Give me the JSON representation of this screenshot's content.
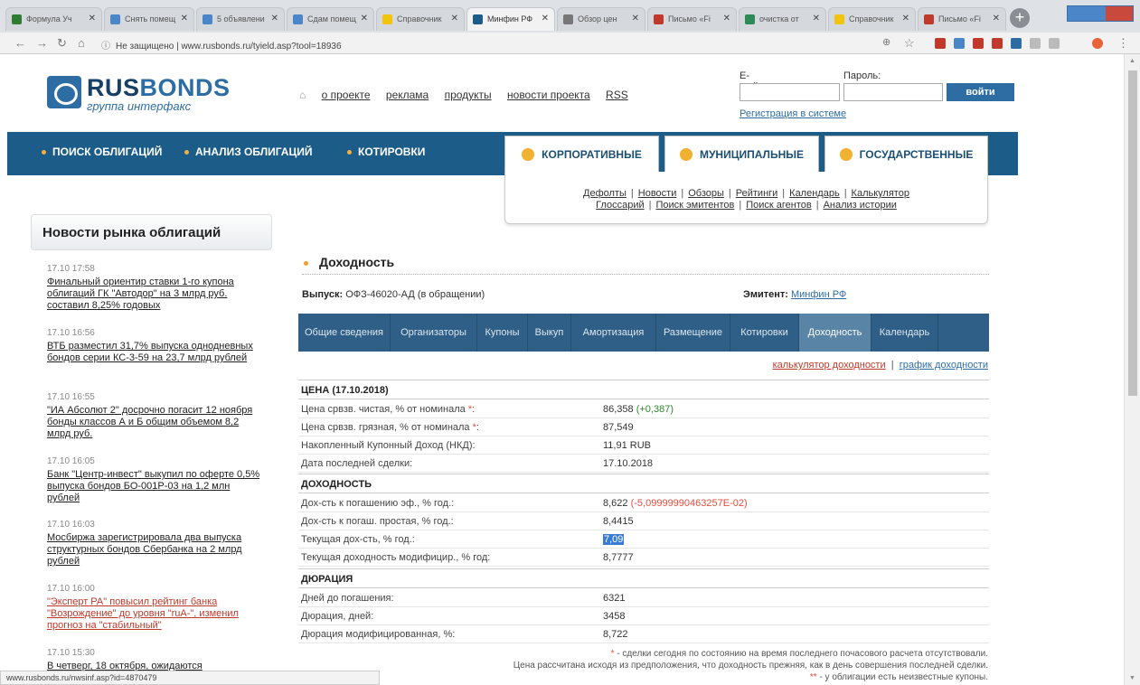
{
  "browser": {
    "tabs": [
      {
        "title": "Формула Уч",
        "color": "#2e7d32"
      },
      {
        "title": "Снять помещ",
        "color": "#4a86c8"
      },
      {
        "title": "5 объявлени",
        "color": "#4a86c8"
      },
      {
        "title": "Сдам помещ",
        "color": "#4a86c8"
      },
      {
        "title": "Справочник",
        "color": "#f1c40f"
      },
      {
        "title": "Минфин РФ",
        "color": "#1b5c88"
      },
      {
        "title": "Обзор цен",
        "color": "#777777"
      },
      {
        "title": "Письмо «Fi",
        "color": "#c0392b"
      },
      {
        "title": "очистка от",
        "color": "#2e8b57"
      },
      {
        "title": "Справочник",
        "color": "#f1c40f"
      },
      {
        "title": "Письмо «Fi",
        "color": "#c0392b"
      }
    ],
    "url_prefix": "Не защищено",
    "url": "www.rusbonds.ru/tyield.asp?tool=18936",
    "status_url": "www.rusbonds.ru/nwsinf.asp?id=4870479"
  },
  "header": {
    "logo_part1": "RUS",
    "logo_part2": "BONDS",
    "tagline": "группа интерфакс",
    "nav": [
      "о проекте",
      "реклама",
      "продукты",
      "новости проекта",
      "RSS"
    ],
    "email_label": "E-mail:",
    "password_label": "Пароль:",
    "login_button": "войти",
    "register_link": "Регистрация в системе"
  },
  "mainnav": {
    "items": [
      "ПОИСК ОБЛИГАЦИЙ",
      "АНАЛИЗ ОБЛИГАЦИЙ",
      "КОТИРОВКИ"
    ],
    "bigtabs": [
      "КОРПОРАТИВНЫЕ",
      "МУНИЦИПАЛЬНЫЕ",
      "ГОСУДАРСТВЕННЫЕ"
    ]
  },
  "submenu": {
    "row1": [
      "Дефолты",
      "Новости",
      "Обзоры",
      "Рейтинги",
      "Календарь",
      "Калькулятор"
    ],
    "row2": [
      "Глоссарий",
      "Поиск эмитентов",
      "Поиск агентов",
      "Анализ истории"
    ]
  },
  "news": {
    "heading": "Новости рынка облигаций",
    "items": [
      {
        "time": "17.10 17:58",
        "text": "Финальный ориентир ставки 1-го купона облигаций ГК \"Автодор\" на 3 млрд руб. составил 8,25% годовых"
      },
      {
        "time": "17.10 16:56",
        "text": "ВТБ разместил 31,7% выпуска однодневных бондов серии КС-3-59 на 23,7 млрд рублей"
      },
      {
        "time": "17.10 16:55",
        "text": "\"ИА Абсолют 2\" досрочно погасит 12 ноября бонды классов А и Б общим объемом 8,2 млрд руб."
      },
      {
        "time": "17.10 16:05",
        "text": "Банк \"Центр-инвест\" выкупил по оферте 0,5% выпуска бондов БО-001Р-03 на 1,2 млн рублей"
      },
      {
        "time": "17.10 16:03",
        "text": "Мосбиржа зарегистрировала два выпуска структурных бондов Сбербанка на 2 млрд рублей"
      },
      {
        "time": "17.10 16:00",
        "text": "\"Эксперт РА\" повысил рейтинг банка \"Возрождение\" до уровня \"ruA-\", изменил прогноз на \"стабильный\""
      },
      {
        "time": "17.10 15:30",
        "text": "В четверг, 18 октября, ожидаются"
      }
    ]
  },
  "content": {
    "title": "Доходность",
    "issue_label": "Выпуск:",
    "issue_value": "ОФЗ-46020-АД (в обращении)",
    "issuer_label": "Эмитент:",
    "issuer_value": "Минфин РФ",
    "tabs": [
      "Общие сведения",
      "Организаторы",
      "Купоны",
      "Выкуп",
      "Амортизация",
      "Размещение",
      "Котировки",
      "Доходность",
      "Календарь"
    ],
    "active_tab": "Доходность",
    "calc_link": "калькулятор доходности",
    "chart_link": "график доходности",
    "price": {
      "heading": "ЦЕНА (17.10.2018)",
      "clean_label": "Цена срвзв. чистая, % от номинала",
      "clean_value": "86,358",
      "clean_change": "(+0,387)",
      "dirty_label": "Цена срвзв. грязная, % от номинала",
      "dirty_value": "87,549",
      "aci_label": "Накопленный Купонный Доход (НКД):",
      "aci_value": "11,91 RUB",
      "lastdeal_label": "Дата последней сделки:",
      "lastdeal_value": "17.10.2018"
    },
    "yield": {
      "heading": "ДОХОДНОСТЬ",
      "eff_label": "Дох-сть к погашению эф., % год.:",
      "eff_value": "8,622",
      "eff_change": "(-5,09999990463257E-02)",
      "simple_label": "Дох-сть к погаш. простая, % год.:",
      "simple_value": "8,4415",
      "current_label": "Текущая дох-сть, % год.:",
      "current_value": "7,09",
      "modified_label": "Текущая доходность модифицир., % год:",
      "modified_value": "8,7777"
    },
    "duration": {
      "heading": "ДЮРАЦИЯ",
      "days_label": "Дней до погашения:",
      "days_value": "6321",
      "dur_label": "Дюрация, дней:",
      "dur_value": "3458",
      "moddur_label": "Дюрация модифицированная, %:",
      "moddur_value": "8,722"
    },
    "footnotes": [
      "- сделки сегодня по состоянию на время последнего почасового расчета отсутствовали.",
      "Цена рассчитана исходя из предположения, что доходность прежняя, как в день совершения последней сделки.",
      "- у облигации есть неизвестные купоны."
    ],
    "footnote_marks": [
      "*",
      "**"
    ]
  }
}
